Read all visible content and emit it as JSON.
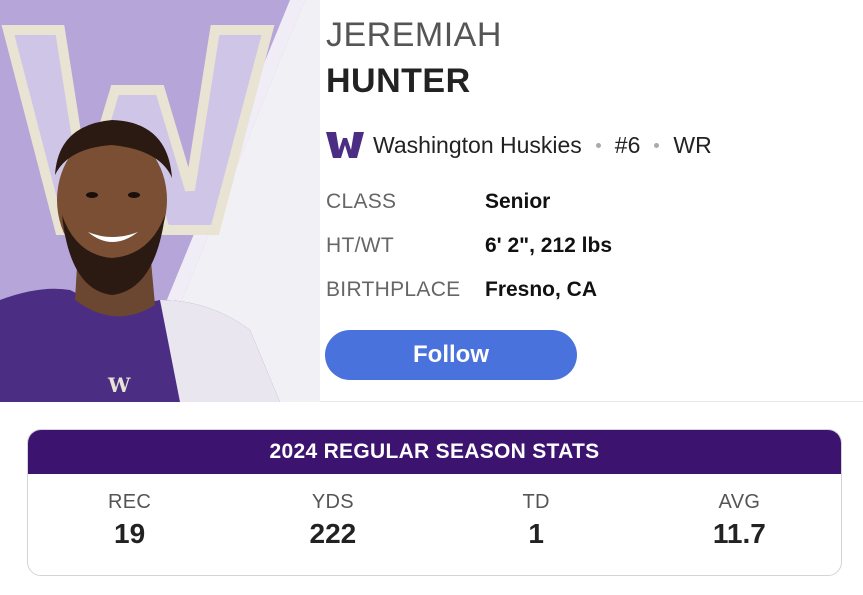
{
  "player": {
    "first_name": "JEREMIAH",
    "last_name": "HUNTER",
    "team": "Washington Huskies",
    "number": "#6",
    "position": "WR",
    "team_logo_icon": "washington-w-logo-icon",
    "photo_icon": "player-headshot"
  },
  "details": [
    {
      "label": "CLASS",
      "value": "Senior"
    },
    {
      "label": "HT/WT",
      "value": "6' 2\", 212 lbs"
    },
    {
      "label": "BIRTHPLACE",
      "value": "Fresno, CA"
    }
  ],
  "follow_label": "Follow",
  "stats": {
    "title": "2024 REGULAR SEASON STATS",
    "items": [
      {
        "label": "REC",
        "value": "19"
      },
      {
        "label": "YDS",
        "value": "222"
      },
      {
        "label": "TD",
        "value": "1"
      },
      {
        "label": "AVG",
        "value": "11.7"
      }
    ]
  },
  "colors": {
    "team_purple": "#3c1470",
    "logo_purple": "#4b2e83",
    "follow_blue": "#4a72dc",
    "panel_lavender": "#b5a5d8",
    "logo_gold": "#e8e3d3"
  }
}
